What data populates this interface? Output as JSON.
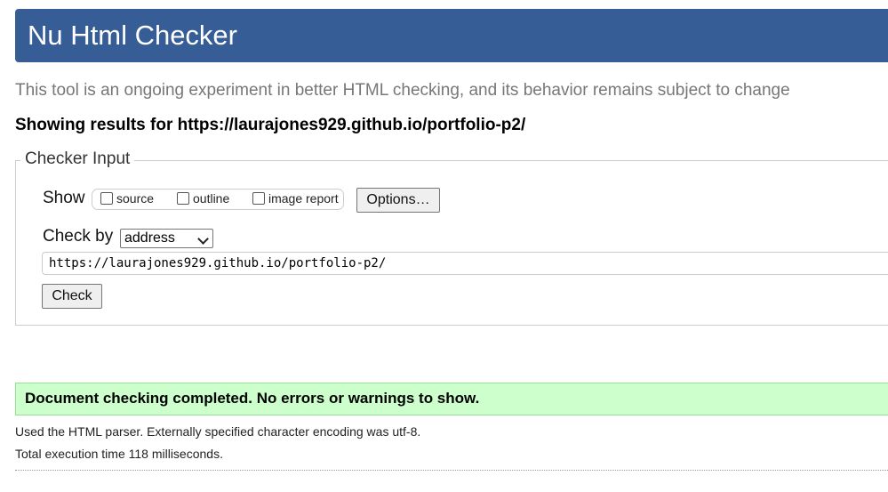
{
  "header": {
    "title": "Nu Html Checker"
  },
  "subtitle": "This tool is an ongoing experiment in better HTML checking, and its behavior remains subject to change",
  "showing_results": "Showing results for https://laurajones929.github.io/portfolio-p2/",
  "checker_input": {
    "legend": "Checker Input",
    "show_label": "Show",
    "options": [
      {
        "label": "source",
        "checked": false
      },
      {
        "label": "outline",
        "checked": false
      },
      {
        "label": "image report",
        "checked": false
      }
    ],
    "options_button": "Options…",
    "check_by_label": "Check by",
    "check_by_selected": "address",
    "url_value": "https://laurajones929.github.io/portfolio-p2/",
    "check_button": "Check"
  },
  "result": {
    "message": "Document checking completed. No errors or warnings to show.",
    "color": "#ccffcc"
  },
  "notes": {
    "parser": "Used the HTML parser. Externally specified character encoding was utf-8.",
    "time": "Total execution time 118 milliseconds."
  },
  "colors": {
    "header_bg": "#365d95"
  }
}
